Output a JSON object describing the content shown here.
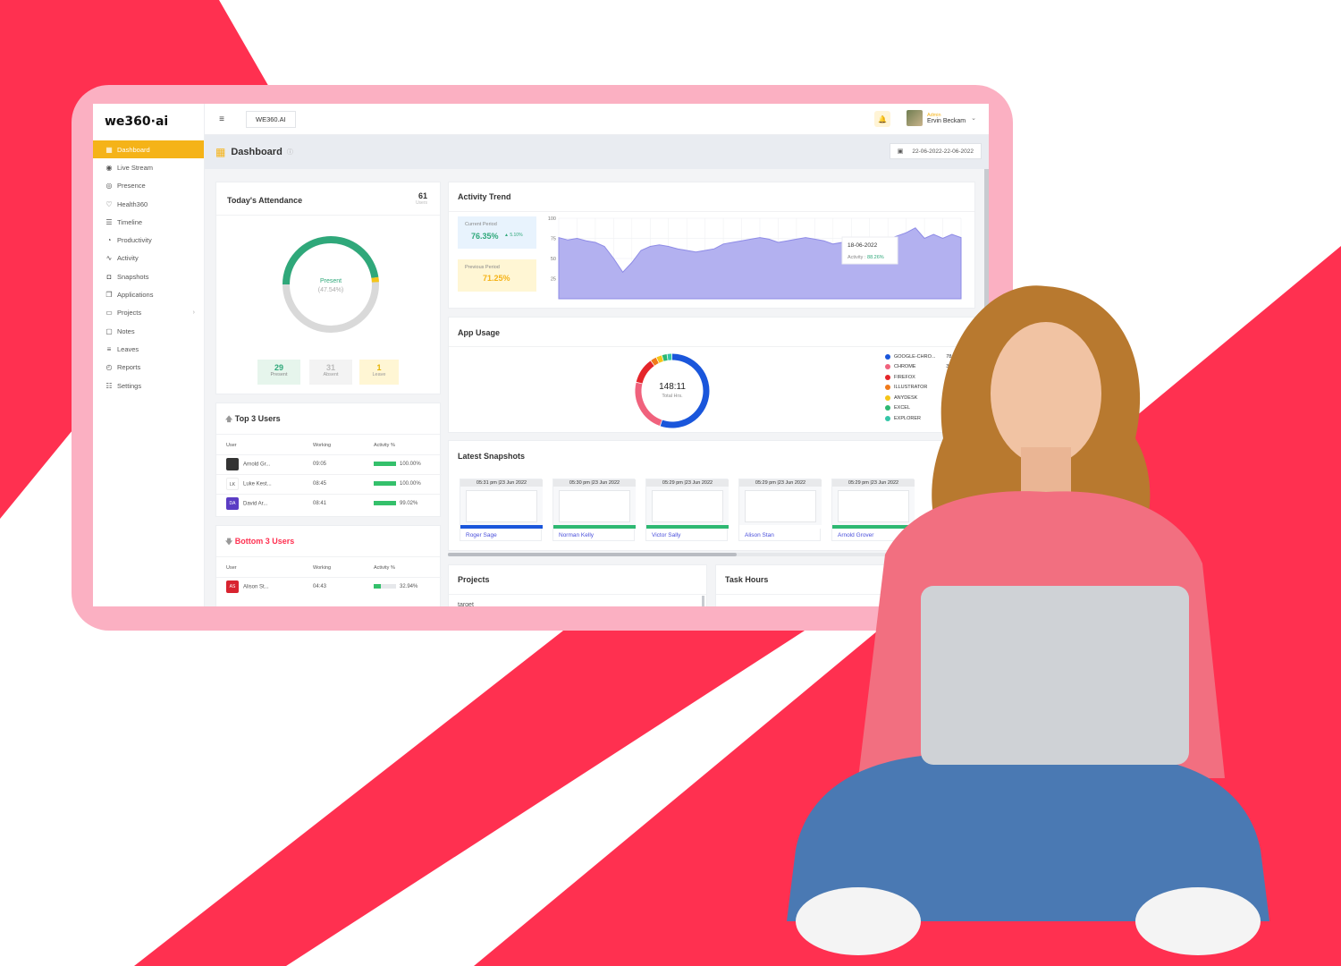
{
  "brand": {
    "logo_text": "we360·ai"
  },
  "sidebar": {
    "items": [
      {
        "label": "Dashboard",
        "icon": "grid-icon",
        "active": true
      },
      {
        "label": "Live Stream",
        "icon": "broadcast-icon"
      },
      {
        "label": "Presence",
        "icon": "fingerprint-icon"
      },
      {
        "label": "Health360",
        "icon": "heart-monitor-icon"
      },
      {
        "label": "Timeline",
        "icon": "timeline-icon"
      },
      {
        "label": "Productivity",
        "icon": "gauge-icon"
      },
      {
        "label": "Activity",
        "icon": "pulse-icon"
      },
      {
        "label": "Snapshots",
        "icon": "camera-icon"
      },
      {
        "label": "Applications",
        "icon": "windows-icon"
      },
      {
        "label": "Projects",
        "icon": "briefcase-icon",
        "has_submenu": true
      },
      {
        "label": "Notes",
        "icon": "note-icon"
      },
      {
        "label": "Leaves",
        "icon": "list-icon"
      },
      {
        "label": "Reports",
        "icon": "pie-icon"
      },
      {
        "label": "Settings",
        "icon": "sliders-icon"
      }
    ]
  },
  "topbar": {
    "org_name": "WE360.AI",
    "user_role": "Admin",
    "user_name": "Ervin Beckam"
  },
  "page": {
    "title": "Dashboard",
    "date_range": "22-06-2022-22-06-2022"
  },
  "attendance": {
    "title": "Today's Attendance",
    "total": "61",
    "total_label": "Users",
    "center_label": "Present",
    "center_value": "(47.54%)",
    "present": {
      "value": "29",
      "label": "Present"
    },
    "absent": {
      "value": "31",
      "label": "Absent"
    },
    "leave": {
      "value": "1",
      "label": "Leave"
    },
    "colors": {
      "present": "#2fa87a",
      "absent": "#d9d9d9",
      "leave": "#f5c518"
    }
  },
  "activity_trend": {
    "title": "Activity Trend",
    "current_label": "Current Period",
    "current_value": "76.35%",
    "change": "5.10%",
    "previous_label": "Previous Period",
    "previous_value": "71.25%",
    "tooltip_date": "18-06-2022",
    "tooltip_label": "Activity :",
    "tooltip_value": "88.26%"
  },
  "chart_data": {
    "type": "area",
    "ylim": [
      0,
      100
    ],
    "yticks": [
      "100",
      "75",
      "50",
      "25"
    ],
    "values": [
      76,
      73,
      75,
      72,
      70,
      65,
      50,
      33,
      45,
      60,
      65,
      67,
      65,
      62,
      60,
      58,
      60,
      62,
      68,
      70,
      72,
      74,
      76,
      74,
      70,
      72,
      74,
      76,
      74,
      72,
      68,
      70,
      74,
      72,
      70,
      72,
      74,
      78,
      82,
      88,
      75,
      80,
      75,
      80,
      76
    ]
  },
  "app_usage": {
    "title": "App Usage",
    "total": "148:11",
    "total_label": "Total Hrs.",
    "apps": [
      {
        "name": "GOOGLE-CHRO...",
        "value": "78:27",
        "color": "#1a56db",
        "hours": 78.45
      },
      {
        "name": "CHROME",
        "value": "33:05",
        "color": "#f0627d",
        "hours": 33.08
      },
      {
        "name": "FIREFOX",
        "value": "16:05",
        "color": "#e5252a",
        "hours": 16.08
      },
      {
        "name": "ILLUSTRATOR",
        "value": "03:52",
        "color": "#f07a1a",
        "hours": 3.87
      },
      {
        "name": "ANYDESK",
        "value": "03:38",
        "color": "#f5c518",
        "hours": 3.63
      },
      {
        "name": "EXCEL",
        "value": "03:13",
        "color": "#2eb872",
        "hours": 3.22
      },
      {
        "name": "EXPLORER",
        "value": "03:00",
        "color": "#34c6a8",
        "hours": 3.0
      }
    ]
  },
  "snapshots": {
    "title": "Latest Snapshots",
    "items": [
      {
        "time": "05:31 pm |23 Jun 2022",
        "name": "Roger Sage"
      },
      {
        "time": "05:30 pm |23 Jun 2022",
        "name": "Norman Kelly"
      },
      {
        "time": "05:29 pm |23 Jun 2022",
        "name": "Victor Sally"
      },
      {
        "time": "05:29 pm |23 Jun 2022",
        "name": "Alison Stan"
      },
      {
        "time": "05:29 pm |23 Jun 2022",
        "name": "Arnold Grover"
      }
    ]
  },
  "top_users": {
    "title": "Top 3 Users",
    "headers": [
      "User",
      "Working",
      "Activity %"
    ],
    "rows": [
      {
        "badge": "",
        "badge_color": "#333333",
        "name": "Arnold Gr...",
        "working": "09:05",
        "activity": "100.00%",
        "pct": 100
      },
      {
        "badge": "LK",
        "badge_color": "#ffffff",
        "name": "Luke Kest...",
        "working": "08:45",
        "activity": "100.00%",
        "pct": 100
      },
      {
        "badge": "DA",
        "badge_color": "#5b3cc4",
        "name": "David Ar...",
        "working": "08:41",
        "activity": "99.02%",
        "pct": 99
      }
    ]
  },
  "bottom_users": {
    "title": "Bottom 3 Users",
    "headers": [
      "User",
      "Working",
      "Activity %"
    ],
    "rows": [
      {
        "badge": "AS",
        "badge_color": "#d8232f",
        "name": "Alison St...",
        "working": "04:43",
        "activity": "32.94%",
        "pct": 33
      }
    ]
  },
  "projects": {
    "title": "Projects",
    "first_item": "target"
  },
  "task_hours": {
    "title": "Task Hours"
  }
}
